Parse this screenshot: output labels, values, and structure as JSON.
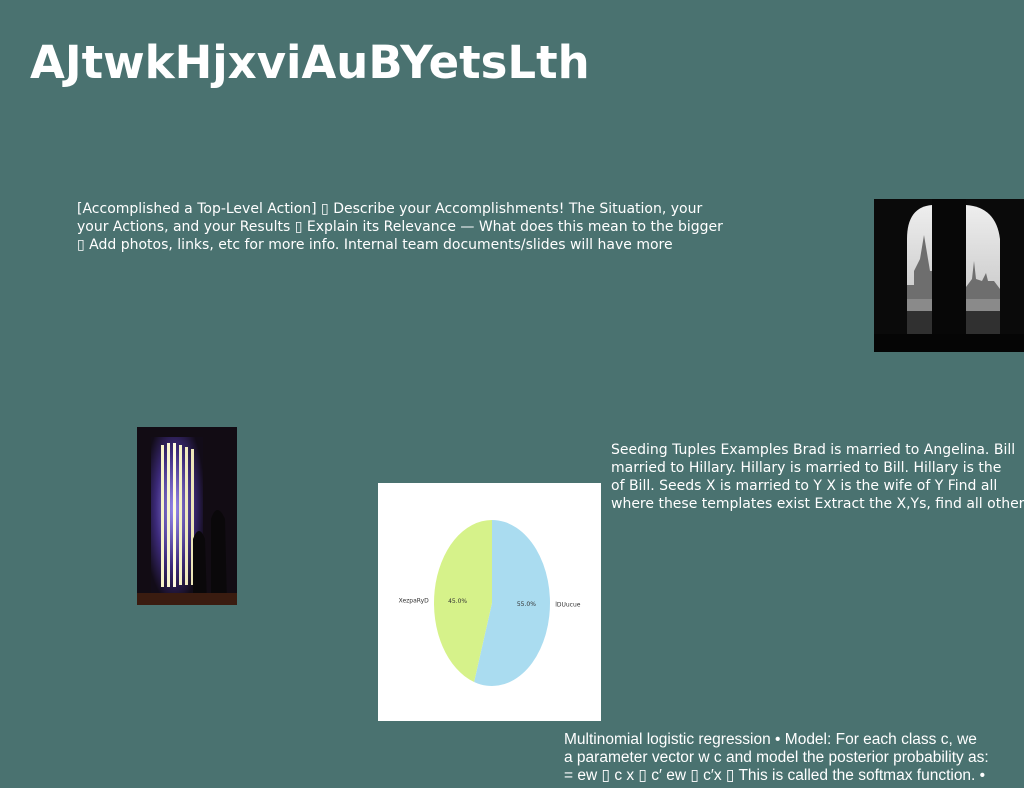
{
  "slide": {
    "title": "AJtwkHjxviAuBYetsLth",
    "text_block_1": {
      "lines": [
        "[Accomplished a Top-Level Action] ▯ Describe your Accomplishments! The Situation, your",
        "your Actions, and your Results ▯ Explain its Relevance — What does this mean to the bigger",
        "▯ Add photos, links, etc for more info. Internal team documents/slides will have more"
      ]
    },
    "text_block_2": {
      "lines": [
        "Seeding Tuples Examples Brad is married to Angelina. Bill",
        "married to Hillary. Hillary is married to Bill. Hillary is the",
        "of Bill. Seeds X is married to Y X is the wife of Y Find all",
        "where these templates exist Extract the X,Ys, find all other"
      ]
    },
    "text_block_3": {
      "lines": [
        "Multinomial logistic regression • Model: For each class c, we",
        "a parameter vector w c and model the posterior probability as:",
        "= ew ▯ c x ▯ c′ ew ▯ c′x ▯ This is called the softmax function. •"
      ]
    },
    "colors": {
      "background": "#4a7270",
      "text": "#ffffff"
    }
  },
  "chart_data": {
    "type": "pie",
    "title": "",
    "slices": [
      {
        "label": "lDUucue",
        "value": 55.0,
        "pct_label": "55.0%",
        "color": "#aadcf0"
      },
      {
        "label": "XezpaRyD",
        "value": 45.0,
        "pct_label": "45.0%",
        "color": "#d6f28a"
      }
    ]
  }
}
